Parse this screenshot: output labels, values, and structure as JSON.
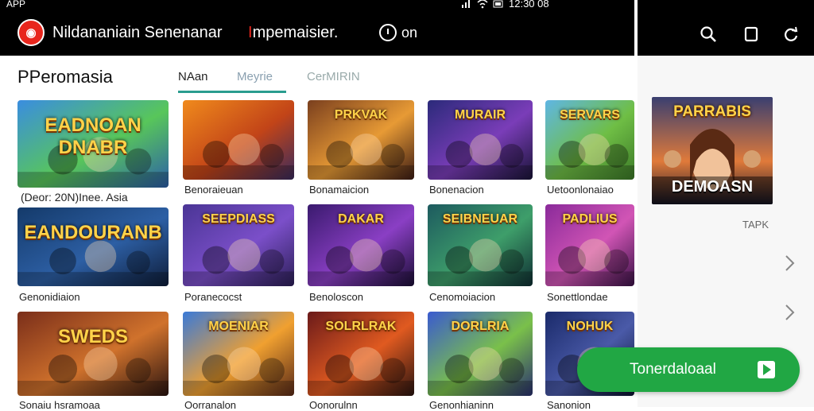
{
  "status": {
    "app": "APP",
    "time": "12:30 08"
  },
  "header": {
    "app_title": "Nildananiain Senenanar",
    "subtitle_accent": "I",
    "subtitle": "mpemaisier.",
    "timer_label": "on"
  },
  "brand": "PPeromasia",
  "tabs": [
    {
      "label": "NAan",
      "active": true
    },
    {
      "label": "Meyrie",
      "active": false
    },
    {
      "label": "CerMIRIN",
      "active": false
    }
  ],
  "tiles": [
    {
      "title": "EADNOAN DNABR",
      "caption": "",
      "colors": [
        "#3a8de0",
        "#58c65a",
        "#2c5fa8"
      ]
    },
    {
      "title": "",
      "caption": "Benoraieuan",
      "colors": [
        "#f08a1c",
        "#c24418",
        "#3a2b5c"
      ]
    },
    {
      "title": "PRKVAK",
      "caption": "Bonamaicion",
      "colors": [
        "#7a3f1e",
        "#e79a35",
        "#3d1c14"
      ]
    },
    {
      "title": "MURAIR",
      "caption": "Bonenacion",
      "colors": [
        "#2b2a7a",
        "#7a3db8",
        "#1a1438"
      ]
    },
    {
      "title": "SERVARS",
      "caption": "Uetoonlonaiao",
      "colors": [
        "#5fb6e4",
        "#6fbe45",
        "#3c7a28"
      ]
    },
    {
      "title": "EANDOURANB",
      "caption": "Genonidiaion",
      "colors": [
        "#143a6a",
        "#2d5fa4",
        "#0e1d3a"
      ]
    },
    {
      "title": "SEEPDIASS",
      "caption": "Poranecocst",
      "colors": [
        "#4a3595",
        "#7b4fc9",
        "#2c1f58"
      ]
    },
    {
      "title": "DAKAR",
      "caption": "Benoloscon",
      "colors": [
        "#3a1a6e",
        "#8a3fc4",
        "#1b0e36"
      ]
    },
    {
      "title": "SEIBNEUAR",
      "caption": "Cenomoiacion",
      "colors": [
        "#1d5a5f",
        "#3e9e6a",
        "#0f2f33"
      ]
    },
    {
      "title": "PADLIUS",
      "caption": "Sonettlondae",
      "colors": [
        "#8a2a9a",
        "#d155b5",
        "#3c1248"
      ]
    },
    {
      "title": "SWEDS",
      "caption": "Sonaiu hsramoaa",
      "colors": [
        "#7a2e1a",
        "#d0722c",
        "#2a1410"
      ]
    },
    {
      "title": "MOENIAR",
      "caption": "Oorranalon",
      "colors": [
        "#3a7ad8",
        "#f0a030",
        "#5a2a18"
      ]
    },
    {
      "title": "SOLRLRAK",
      "caption": "Oonorulnn",
      "colors": [
        "#6a1a1a",
        "#e05a20",
        "#2a1410"
      ]
    },
    {
      "title": "DORLRIA",
      "caption": "Genonhianinn",
      "colors": [
        "#3a5ad0",
        "#7ac04a",
        "#2a3070"
      ]
    },
    {
      "title": "NOHUK",
      "caption": "Sanonion",
      "colors": [
        "#1a2a6a",
        "#4a5aa8",
        "#0e1534"
      ]
    }
  ],
  "overlay_label": "(Deor: 20N)Inee. Asia",
  "featured": {
    "title": "PARRABIS",
    "subtitle": "DEMOASN",
    "colors": [
      "#3a3f70",
      "#e07a3a",
      "#1a1a2a"
    ]
  },
  "right_label": "TAPK",
  "download": {
    "label": "Tonerdaloaal"
  },
  "icons": {
    "logo": "logo-icon",
    "timer": "clock-icon",
    "search": "search-icon",
    "square": "square-icon",
    "refresh": "refresh-icon",
    "play": "play-icon",
    "chevron": "chevron-right-icon"
  },
  "accent_color": "#21a744"
}
